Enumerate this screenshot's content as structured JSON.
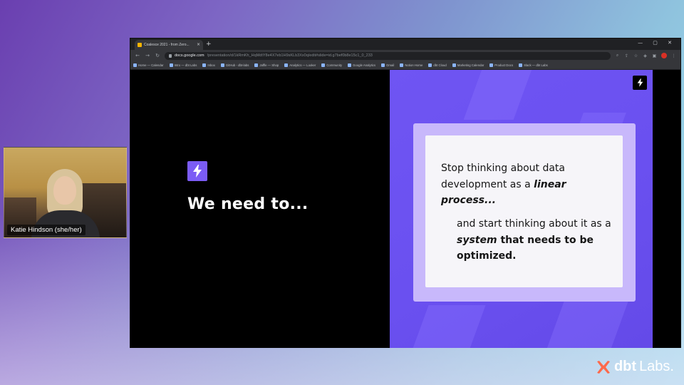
{
  "webcam": {
    "participant_name": "Katie Hindson (she/her)"
  },
  "browser": {
    "tab_title": "Coalesce 2021 - from Zero...",
    "tab_close": "×",
    "new_tab": "+",
    "url_host": "docs.google.com",
    "url_path": "/presentation/d/1kRmKh_HqMdtY8e4X7eb1H9sKLb3Xx0q/edit#slide=id.g7bef0b8e15c1_0_233",
    "bookmarks": [
      "Home — Calendar",
      "Intro — dbt Labs",
      "Inbox",
      "GitHub - dbt-labs",
      "Jaffle — Shop",
      "Analytics — Looker",
      "Community",
      "Google Analytics",
      "Gmail",
      "Notion Home",
      "dbt Cloud",
      "Marketing Calendar",
      "Product Docs",
      "Slack — dbt Labs"
    ]
  },
  "slide": {
    "heading": "We need to...",
    "quote_part1_pre": "Stop thinking about data development as a ",
    "quote_part1_emph": "linear process...",
    "quote_part2_pre": "and start thinking about it as a ",
    "quote_part2_emph": "system",
    "quote_part2_post": " that needs to be optimized."
  },
  "brand": {
    "name_bold": "dbt",
    "name_light": "Labs."
  },
  "colors": {
    "slide_accent": "#7b5cf5",
    "quote_frame": "#c8b8fb",
    "quote_card": "#f6f5f9",
    "brand_mark": "#ff694b"
  },
  "icons": [
    "bolt-icon",
    "dbt-logo-icon",
    "lock-icon",
    "back-icon",
    "forward-icon",
    "reload-icon"
  ]
}
